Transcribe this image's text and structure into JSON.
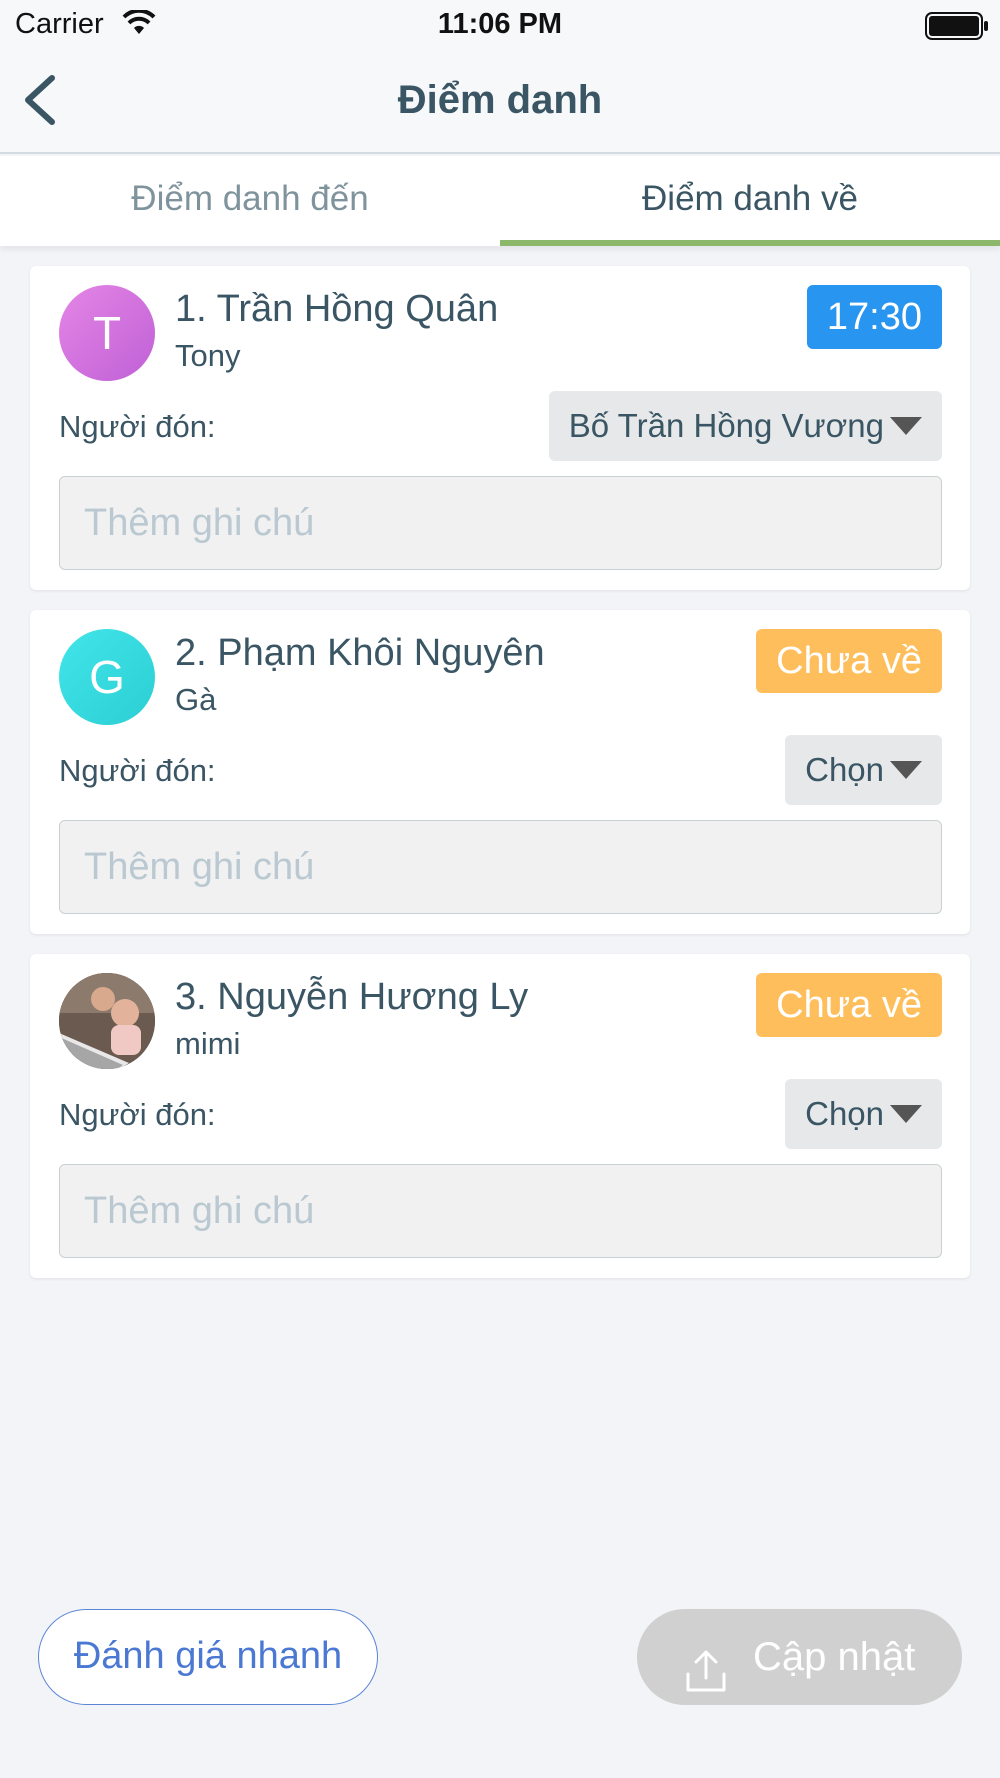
{
  "status_bar": {
    "carrier": "Carrier",
    "time": "11:06 PM"
  },
  "nav": {
    "title": "Điểm danh"
  },
  "tabs": [
    {
      "label": "Điểm danh đến",
      "active": false
    },
    {
      "label": "Điểm danh về",
      "active": true
    }
  ],
  "students": [
    {
      "name": "1. Trần Hồng Quân",
      "nickname": "Tony",
      "avatar_letter": "T",
      "status": "17:30",
      "status_color": "#2895f0",
      "picker_label": "Người đón:",
      "picker_value": "Bố Trần Hồng Vương",
      "note_placeholder": "Thêm ghi chú"
    },
    {
      "name": "2. Phạm Khôi Nguyên",
      "nickname": "Gà",
      "avatar_letter": "G",
      "status": "Chưa về",
      "status_color": "#ffbe5c",
      "picker_label": "Người đón:",
      "picker_value": "Chọn",
      "note_placeholder": "Thêm ghi chú"
    },
    {
      "name": "3. Nguyễn Hương Ly",
      "nickname": "mimi",
      "avatar_letter": "",
      "status": "Chưa về",
      "status_color": "#ffbe5c",
      "picker_label": "Người đón:",
      "picker_value": "Chọn",
      "note_placeholder": "Thêm ghi chú"
    }
  ],
  "actions": {
    "quick_eval_label": "Đánh giá nhanh",
    "update_label": "Cập nhật"
  },
  "colors": {
    "accent_green": "#8bb86a",
    "primary_text": "#3a5563",
    "link_blue": "#4a78d2"
  }
}
